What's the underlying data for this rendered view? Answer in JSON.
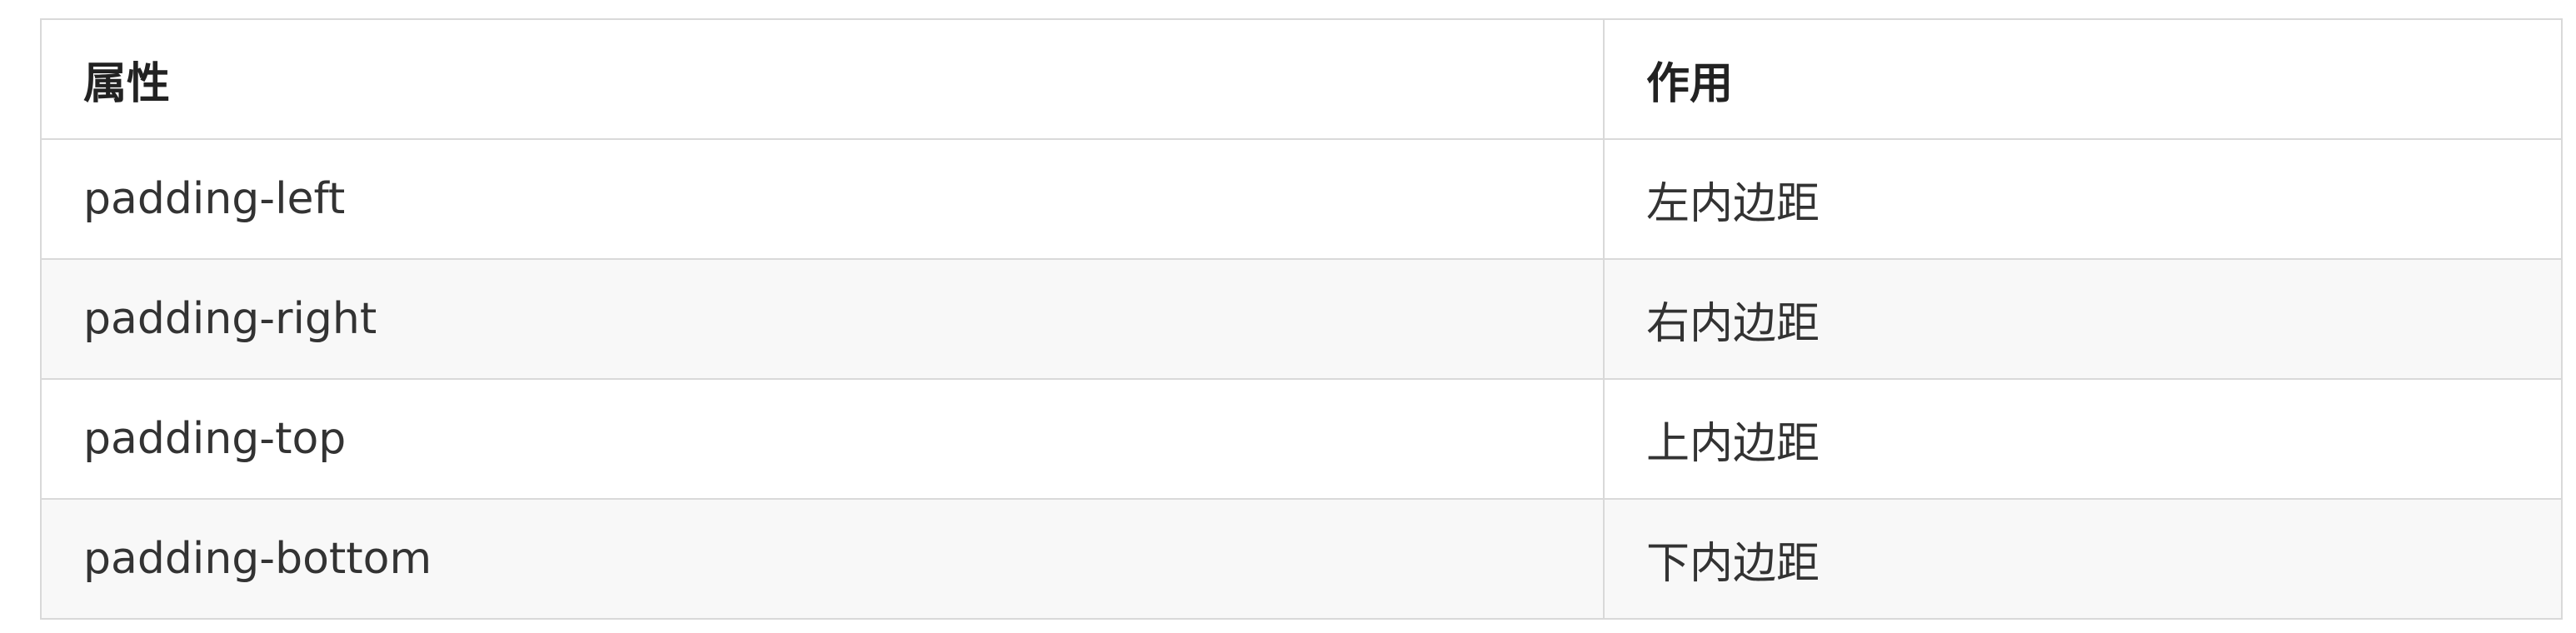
{
  "table": {
    "headers": [
      "属性",
      "作用"
    ],
    "rows": [
      [
        "padding-left",
        "左内边距"
      ],
      [
        "padding-right",
        "右内边距"
      ],
      [
        "padding-top",
        "上内边距"
      ],
      [
        "padding-bottom",
        "下内边距"
      ]
    ]
  },
  "colors": {
    "border": "#d9d9d9",
    "stripe": "#f8f8f8",
    "text": "#333333"
  }
}
